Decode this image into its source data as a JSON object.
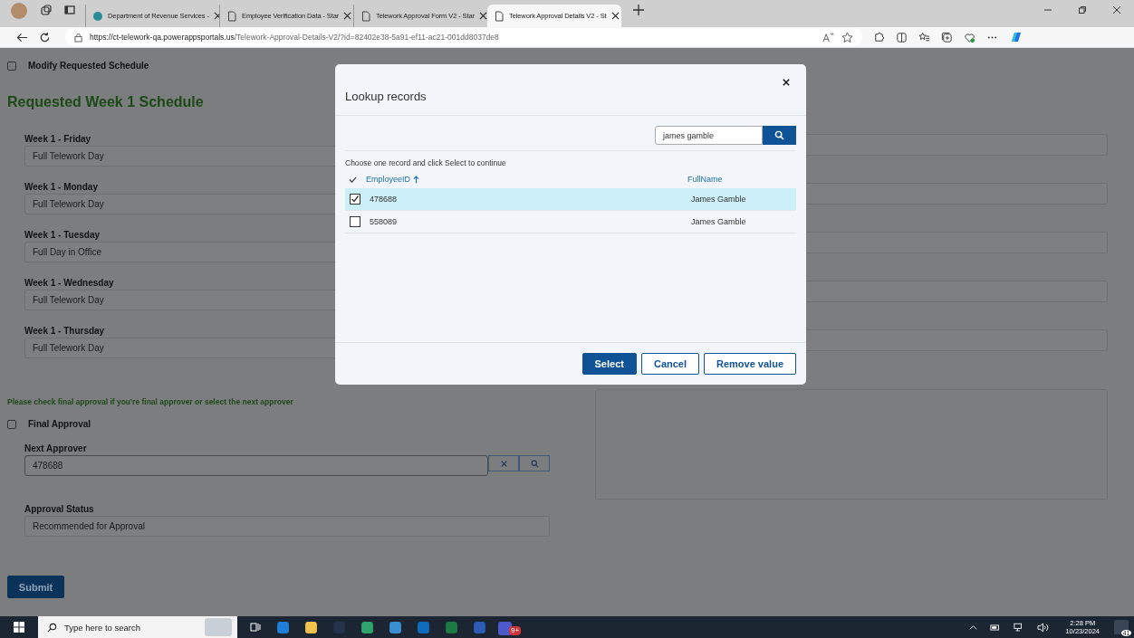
{
  "browser": {
    "tabs": [
      {
        "title": "Department of Revenue Services -",
        "selected": false
      },
      {
        "title": "Employee Verification Data - Star",
        "selected": false
      },
      {
        "title": "Telework Approval Form V2 - Star",
        "selected": false
      },
      {
        "title": "Telework Approval Details V2 - St",
        "selected": true
      }
    ],
    "url_host": "https://ct-telework-qa.powerappsportals.us",
    "url_path": "/Telework-Approval-Details-V2/?id=82402e38-5a91-ef11-ac21-001dd8037de8"
  },
  "page": {
    "modify_schedule": {
      "label": "Modify Requested Schedule",
      "checked": false
    },
    "heading": "Requested Week 1 Schedule",
    "week_fields": [
      {
        "label": "Week 1 - Friday",
        "value": "Full Telework Day"
      },
      {
        "label": "Week 1 - Monday",
        "value": "Full Telework Day"
      },
      {
        "label": "Week 1 - Tuesday",
        "value": "Full Day in Office"
      },
      {
        "label": "Week 1 - Wednesday",
        "value": "Full Telework Day"
      },
      {
        "label": "Week 1 - Thursday",
        "value": "Full Telework Day"
      }
    ],
    "note": "Please check final approval if you're final approver or select the next approver",
    "final_approval": {
      "label": "Final Approval",
      "checked": false
    },
    "next_approver": {
      "label": "Next Approver",
      "value": "478688"
    },
    "approval_status": {
      "label": "Approval Status",
      "value": "Recommended for Approval"
    },
    "submit": "Submit"
  },
  "dialog": {
    "title": "Lookup records",
    "search": {
      "value": "james gamble"
    },
    "instruction": "Choose one record and click Select to continue",
    "columns": [
      {
        "label": "EmployeeID",
        "sorted": true
      },
      {
        "label": "FullName",
        "sorted": false
      }
    ],
    "rows": [
      {
        "employee_id": "478688",
        "full_name": "James Gamble",
        "selected": true
      },
      {
        "employee_id": "558089",
        "full_name": "James Gamble",
        "selected": false
      }
    ],
    "buttons": [
      {
        "label": "Select",
        "kind": "primary"
      },
      {
        "label": "Cancel",
        "kind": "secondary"
      },
      {
        "label": "Remove value",
        "kind": "secondary"
      }
    ]
  },
  "taskbar": {
    "search_placeholder": "Type here to search",
    "teams_badge": "9+",
    "time": "2:28 PM",
    "date": "10/23/2024",
    "notifications": "41"
  }
}
